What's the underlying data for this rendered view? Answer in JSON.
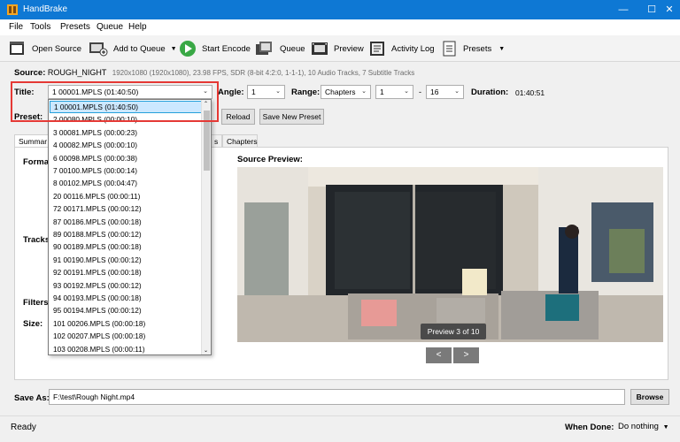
{
  "window": {
    "title": "HandBrake",
    "min": "—",
    "max": "☐",
    "close": "✕"
  },
  "menu": [
    "File",
    "Tools",
    "Presets",
    "Queue",
    "Help"
  ],
  "toolbar": {
    "open_source": "Open Source",
    "add_to_queue": "Add to Queue",
    "start_encode": "Start Encode",
    "queue": "Queue",
    "preview": "Preview",
    "activity_log": "Activity Log",
    "presets": "Presets"
  },
  "source": {
    "label": "Source:",
    "name": "ROUGH_NIGHT",
    "details": "1920x1080 (1920x1080), 23.98 FPS, SDR (8-bit 4:2:0, 1-1-1), 10 Audio Tracks, 7 Subtitle Tracks"
  },
  "title_row": {
    "title_label": "Title:",
    "title_value": "1 00001.MPLS (01:40:50)",
    "angle_label": "Angle:",
    "angle_value": "1",
    "range_label": "Range:",
    "range_value": "Chapters",
    "range_start": "1",
    "range_dash": "-",
    "range_end": "16",
    "duration_label": "Duration:",
    "duration_value": "01:40:51"
  },
  "preset_row": {
    "label": "Preset:",
    "reload": "Reload",
    "save_new": "Save New Preset"
  },
  "dropdown": {
    "items": [
      "1 00001.MPLS (01:40:50)",
      "2 00080.MPLS (00:00:10)",
      "3 00081.MPLS (00:00:23)",
      "4 00082.MPLS (00:00:10)",
      "6 00098.MPLS (00:00:38)",
      "7 00100.MPLS (00:00:14)",
      "8 00102.MPLS (00:04:47)",
      "20 00116.MPLS (00:00:11)",
      "72 00171.MPLS (00:00:12)",
      "87 00186.MPLS (00:00:18)",
      "89 00188.MPLS (00:00:12)",
      "90 00189.MPLS (00:00:18)",
      "91 00190.MPLS (00:00:12)",
      "92 00191.MPLS (00:00:18)",
      "93 00192.MPLS (00:00:12)",
      "94 00193.MPLS (00:00:18)",
      "95 00194.MPLS (00:00:12)",
      "101 00206.MPLS (00:00:18)",
      "102 00207.MPLS (00:00:18)",
      "103 00208.MPLS (00:00:11)"
    ]
  },
  "tabs": {
    "summary": "Summar",
    "s_tab": "s",
    "chapters": "Chapters"
  },
  "summary": {
    "format": "Forma",
    "tracks": "Tracks",
    "filters": "Filters",
    "size": "Size:"
  },
  "preview": {
    "label": "Source Preview:",
    "counter": "Preview 3 of 10",
    "prev": "<",
    "next": ">"
  },
  "save_as": {
    "label": "Save As:",
    "value": "F:\\test\\Rough Night.mp4",
    "browse": "Browse"
  },
  "status": {
    "ready": "Ready",
    "when_done_label": "When Done:",
    "when_done_value": "Do nothing"
  },
  "colors": {
    "titlebar": "#0e78d4",
    "highlight": "#e53935",
    "selection": "#cce8ff"
  }
}
